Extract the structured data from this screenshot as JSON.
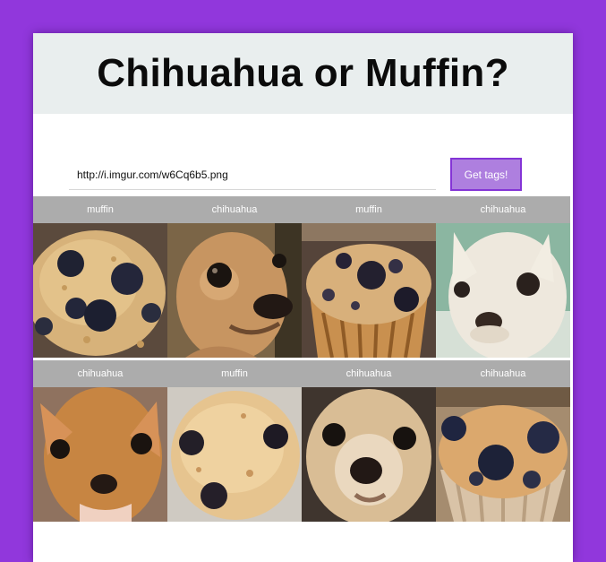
{
  "page": {
    "title": "Chihuahua or Muffin?"
  },
  "form": {
    "url_value": "http://i.imgur.com/w6Cq6b5.png",
    "button_label": "Get tags!"
  },
  "results": [
    {
      "tag": "muffin",
      "subject": "blueberry muffin"
    },
    {
      "tag": "chihuahua",
      "subject": "chihuahua"
    },
    {
      "tag": "muffin",
      "subject": "blueberry muffin"
    },
    {
      "tag": "chihuahua",
      "subject": "chihuahua"
    },
    {
      "tag": "chihuahua",
      "subject": "chihuahua"
    },
    {
      "tag": "muffin",
      "subject": "blueberry muffin"
    },
    {
      "tag": "chihuahua",
      "subject": "chihuahua"
    },
    {
      "tag": "chihuahua",
      "subject": "blueberry muffin"
    }
  ],
  "colors": {
    "background": "#9137dc",
    "header_bg": "#e9eeee",
    "label_bg": "#acacac",
    "button_bg": "#ae7fdf",
    "button_border": "#8434d6"
  }
}
